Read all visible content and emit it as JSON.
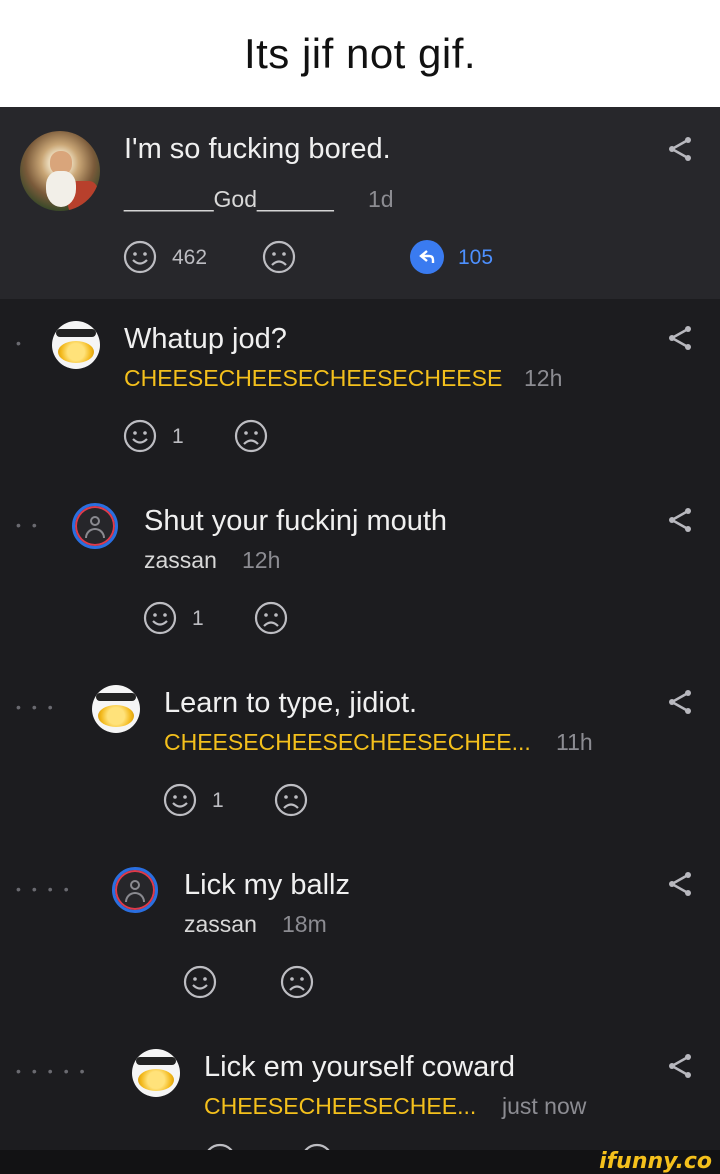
{
  "caption": "Its jif not gif.",
  "post": {
    "text": "I'm so fucking bored.",
    "username": "_______God______",
    "time": "1d",
    "smile_count": "462",
    "reply_count": "105",
    "accent_color": "#4d90ff"
  },
  "comments": [
    {
      "text": "Whatup jod?",
      "username": "CHEESECHEESECHEESECHEESE",
      "time": "12h",
      "smile_count": "1",
      "avatar": "cheese-avatar",
      "depth": 1
    },
    {
      "text": "Shut your fuckinj mouth",
      "username": "zassan",
      "time": "12h",
      "smile_count": "1",
      "avatar": "zassan-avatar",
      "depth": 2
    },
    {
      "text": "Learn to type, jidiot.",
      "username": "CHEESECHEESECHEESECHEE...",
      "time": "11h",
      "smile_count": "1",
      "avatar": "cheese-avatar",
      "depth": 3
    },
    {
      "text": "Lick my ballz",
      "username": "zassan",
      "time": "18m",
      "smile_count": "",
      "avatar": "zassan-avatar",
      "depth": 4
    },
    {
      "text": "Lick em yourself coward",
      "username": "CHEESECHEESECHEE...",
      "time": "just now",
      "smile_count": "",
      "avatar": "cheese-avatar",
      "depth": 5
    }
  ],
  "icons": {
    "smile": "smile-icon",
    "frown": "frown-icon",
    "share": "share-icon",
    "reply": "reply-icon"
  },
  "colors": {
    "cheese_username": "#f4c01c",
    "background": "#1c1c1f",
    "post_background": "#27272b"
  },
  "watermark": "ifunny.co"
}
